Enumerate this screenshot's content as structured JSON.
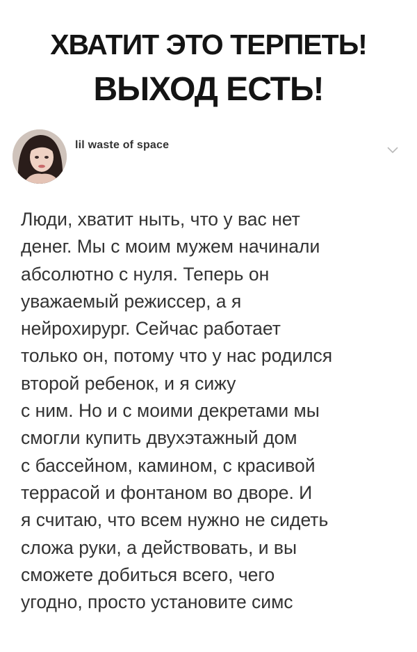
{
  "headline": {
    "line1": "ХВАТИТ ЭТО ТЕРПЕТЬ!",
    "line2": "ВЫХОД ЕСТЬ!"
  },
  "post": {
    "username": "lil waste of space",
    "avatar_icon": "user-avatar-photo",
    "menu_icon": "chevron-down-icon",
    "body_lines": [
      "Люди, хватит ныть, что у вас нет",
      "денег. Мы с моим мужем начинали",
      "абсолютно с нуля. Теперь он",
      "уважаемый режиссер, а я",
      "нейрохирург. Сейчас работает",
      "только он, потому что у нас родился",
      "второй ребенок, и я сижу",
      "с ним. Но и с моими декретами мы",
      "смогли купить двухэтажный дом",
      "с бассейном, камином, с красивой",
      "террасой и фонтаном во дворе. И",
      "я считаю, что всем нужно не сидеть",
      "сложа руки, а действовать, и вы",
      "сможете добиться всего, чего",
      "угодно, просто установите симс"
    ]
  },
  "colors": {
    "text": "#333333",
    "headline": "#141414",
    "chevron": "#b8b8b8"
  }
}
